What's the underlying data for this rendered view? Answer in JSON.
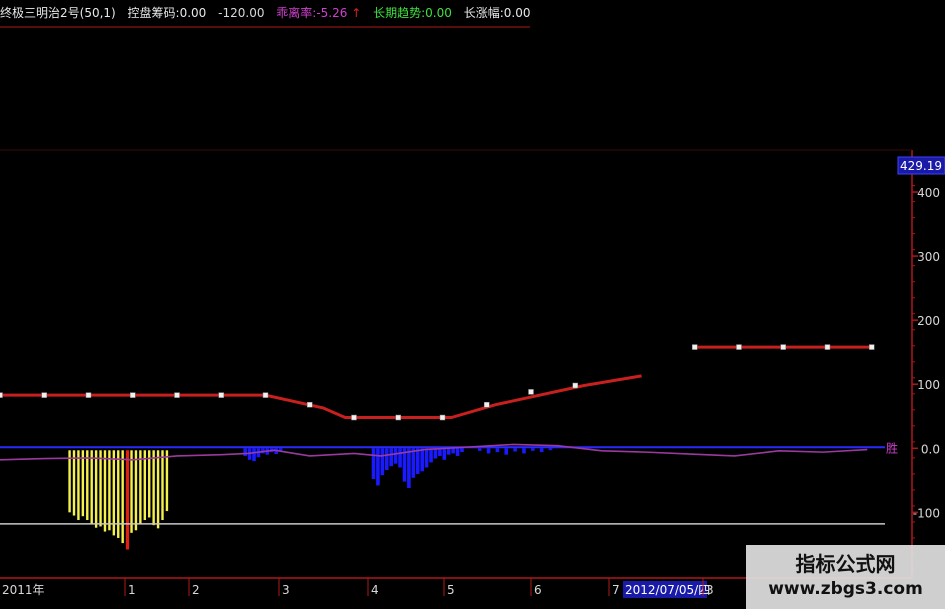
{
  "header": {
    "indicator_name": "终极三明治2号(50,1)",
    "kongpan_label": "控盘筹码:",
    "kongpan_value": "0.00",
    "unnamed_value": "-120.00",
    "bias_label": "乖离率:",
    "bias_value": "-5.26",
    "trend_label": "长期趋势:",
    "trend_value": "0.00",
    "change_label": "长涨幅:",
    "change_value": "0.00"
  },
  "colors": {
    "background": "#000000",
    "axis": "#b01818",
    "grid": "#6e1010",
    "trend_line": "#c8201e",
    "zero_line": "#2a2aff",
    "bias_line": "#9a3aa0",
    "yellow_bars": "#f4f04c",
    "blue_bars": "#1a1aff",
    "highlight_box": "#1a1aa8",
    "white_line": "#c8c8c8"
  },
  "watermark": {
    "title": "指标公式网",
    "url": "www.zbgs3.com"
  },
  "chart_data": {
    "type": "line",
    "ylim": [
      -190,
      450
    ],
    "current_value_label": "429.19",
    "yticks": [
      {
        "value": 400,
        "label": "400"
      },
      {
        "value": 300,
        "label": "300"
      },
      {
        "value": 200,
        "label": "200"
      },
      {
        "value": 100,
        "label": "100"
      },
      {
        "value": 0,
        "label": "0.0"
      },
      {
        "value": -100,
        "label": "-100"
      }
    ],
    "x_labels": [
      "2011年",
      "1",
      "2",
      "3",
      "4",
      "5",
      "6",
      "7",
      "2012/07/05/四",
      "3"
    ],
    "series_labels": [
      "胜"
    ],
    "x_range": [
      0,
      200
    ],
    "trend_line": {
      "points": [
        [
          0,
          83
        ],
        [
          60,
          83
        ],
        [
          73,
          63
        ],
        [
          78,
          48
        ],
        [
          102,
          48
        ],
        [
          112,
          68
        ],
        [
          132,
          98
        ],
        [
          145,
          113
        ]
      ],
      "points2": [
        [
          157,
          158
        ],
        [
          197,
          158
        ]
      ],
      "markers": [
        [
          0,
          83
        ],
        [
          10,
          83
        ],
        [
          20,
          83
        ],
        [
          30,
          83
        ],
        [
          40,
          83
        ],
        [
          50,
          83
        ],
        [
          60,
          83
        ],
        [
          70,
          68
        ],
        [
          80,
          48
        ],
        [
          90,
          48
        ],
        [
          100,
          48
        ],
        [
          110,
          68
        ],
        [
          120,
          88
        ],
        [
          130,
          98
        ],
        [
          157,
          158
        ],
        [
          167,
          158
        ],
        [
          177,
          158
        ],
        [
          187,
          158
        ],
        [
          197,
          158
        ]
      ]
    },
    "bias_line": [
      [
        0,
        -18
      ],
      [
        10,
        -16
      ],
      [
        20,
        -15
      ],
      [
        30,
        -18
      ],
      [
        40,
        -12
      ],
      [
        50,
        -10
      ],
      [
        56,
        -8
      ],
      [
        62,
        -3
      ],
      [
        70,
        -12
      ],
      [
        80,
        -8
      ],
      [
        86,
        -12
      ],
      [
        96,
        -2
      ],
      [
        106,
        2
      ],
      [
        116,
        6
      ],
      [
        126,
        4
      ],
      [
        136,
        -4
      ],
      [
        146,
        -6
      ],
      [
        156,
        -9
      ],
      [
        166,
        -12
      ],
      [
        176,
        -4
      ],
      [
        186,
        -6
      ],
      [
        196,
        -2
      ]
    ],
    "white_line_value": -118,
    "yellow_bars": [
      {
        "x": 15,
        "value": -100
      },
      {
        "x": 16,
        "value": -105
      },
      {
        "x": 17,
        "value": -112
      },
      {
        "x": 18,
        "value": -106
      },
      {
        "x": 19,
        "value": -112
      },
      {
        "x": 20,
        "value": -118
      },
      {
        "x": 21,
        "value": -124
      },
      {
        "x": 22,
        "value": -122
      },
      {
        "x": 23,
        "value": -130
      },
      {
        "x": 24,
        "value": -128
      },
      {
        "x": 25,
        "value": -136
      },
      {
        "x": 26,
        "value": -140
      },
      {
        "x": 27,
        "value": -148
      },
      {
        "x": 28,
        "value": -158,
        "color": "red"
      },
      {
        "x": 29,
        "value": -132
      },
      {
        "x": 30,
        "value": -128
      },
      {
        "x": 31,
        "value": -118
      },
      {
        "x": 32,
        "value": -112
      },
      {
        "x": 33,
        "value": -108
      },
      {
        "x": 34,
        "value": -120
      },
      {
        "x": 35,
        "value": -125
      },
      {
        "x": 36,
        "value": -112
      },
      {
        "x": 37,
        "value": -98
      }
    ],
    "blue_bars": [
      {
        "x": 55,
        "value": -12
      },
      {
        "x": 56,
        "value": -18
      },
      {
        "x": 57,
        "value": -20
      },
      {
        "x": 58,
        "value": -14
      },
      {
        "x": 59,
        "value": -8
      },
      {
        "x": 60,
        "value": -10
      },
      {
        "x": 61,
        "value": -6
      },
      {
        "x": 62,
        "value": -9
      },
      {
        "x": 63,
        "value": -4
      },
      {
        "x": 84,
        "value": -48
      },
      {
        "x": 85,
        "value": -58
      },
      {
        "x": 86,
        "value": -42
      },
      {
        "x": 87,
        "value": -34
      },
      {
        "x": 88,
        "value": -28
      },
      {
        "x": 89,
        "value": -24
      },
      {
        "x": 90,
        "value": -30
      },
      {
        "x": 91,
        "value": -52
      },
      {
        "x": 92,
        "value": -62
      },
      {
        "x": 93,
        "value": -46
      },
      {
        "x": 94,
        "value": -40
      },
      {
        "x": 95,
        "value": -36
      },
      {
        "x": 96,
        "value": -30
      },
      {
        "x": 97,
        "value": -22
      },
      {
        "x": 98,
        "value": -16
      },
      {
        "x": 99,
        "value": -12
      },
      {
        "x": 100,
        "value": -18
      },
      {
        "x": 101,
        "value": -10
      },
      {
        "x": 102,
        "value": -8
      },
      {
        "x": 103,
        "value": -12
      },
      {
        "x": 104,
        "value": -6
      },
      {
        "x": 108,
        "value": -4
      },
      {
        "x": 110,
        "value": -8
      },
      {
        "x": 112,
        "value": -6
      },
      {
        "x": 114,
        "value": -10
      },
      {
        "x": 116,
        "value": -5
      },
      {
        "x": 118,
        "value": -8
      },
      {
        "x": 120,
        "value": -4
      },
      {
        "x": 122,
        "value": -6
      },
      {
        "x": 124,
        "value": -3
      }
    ]
  }
}
